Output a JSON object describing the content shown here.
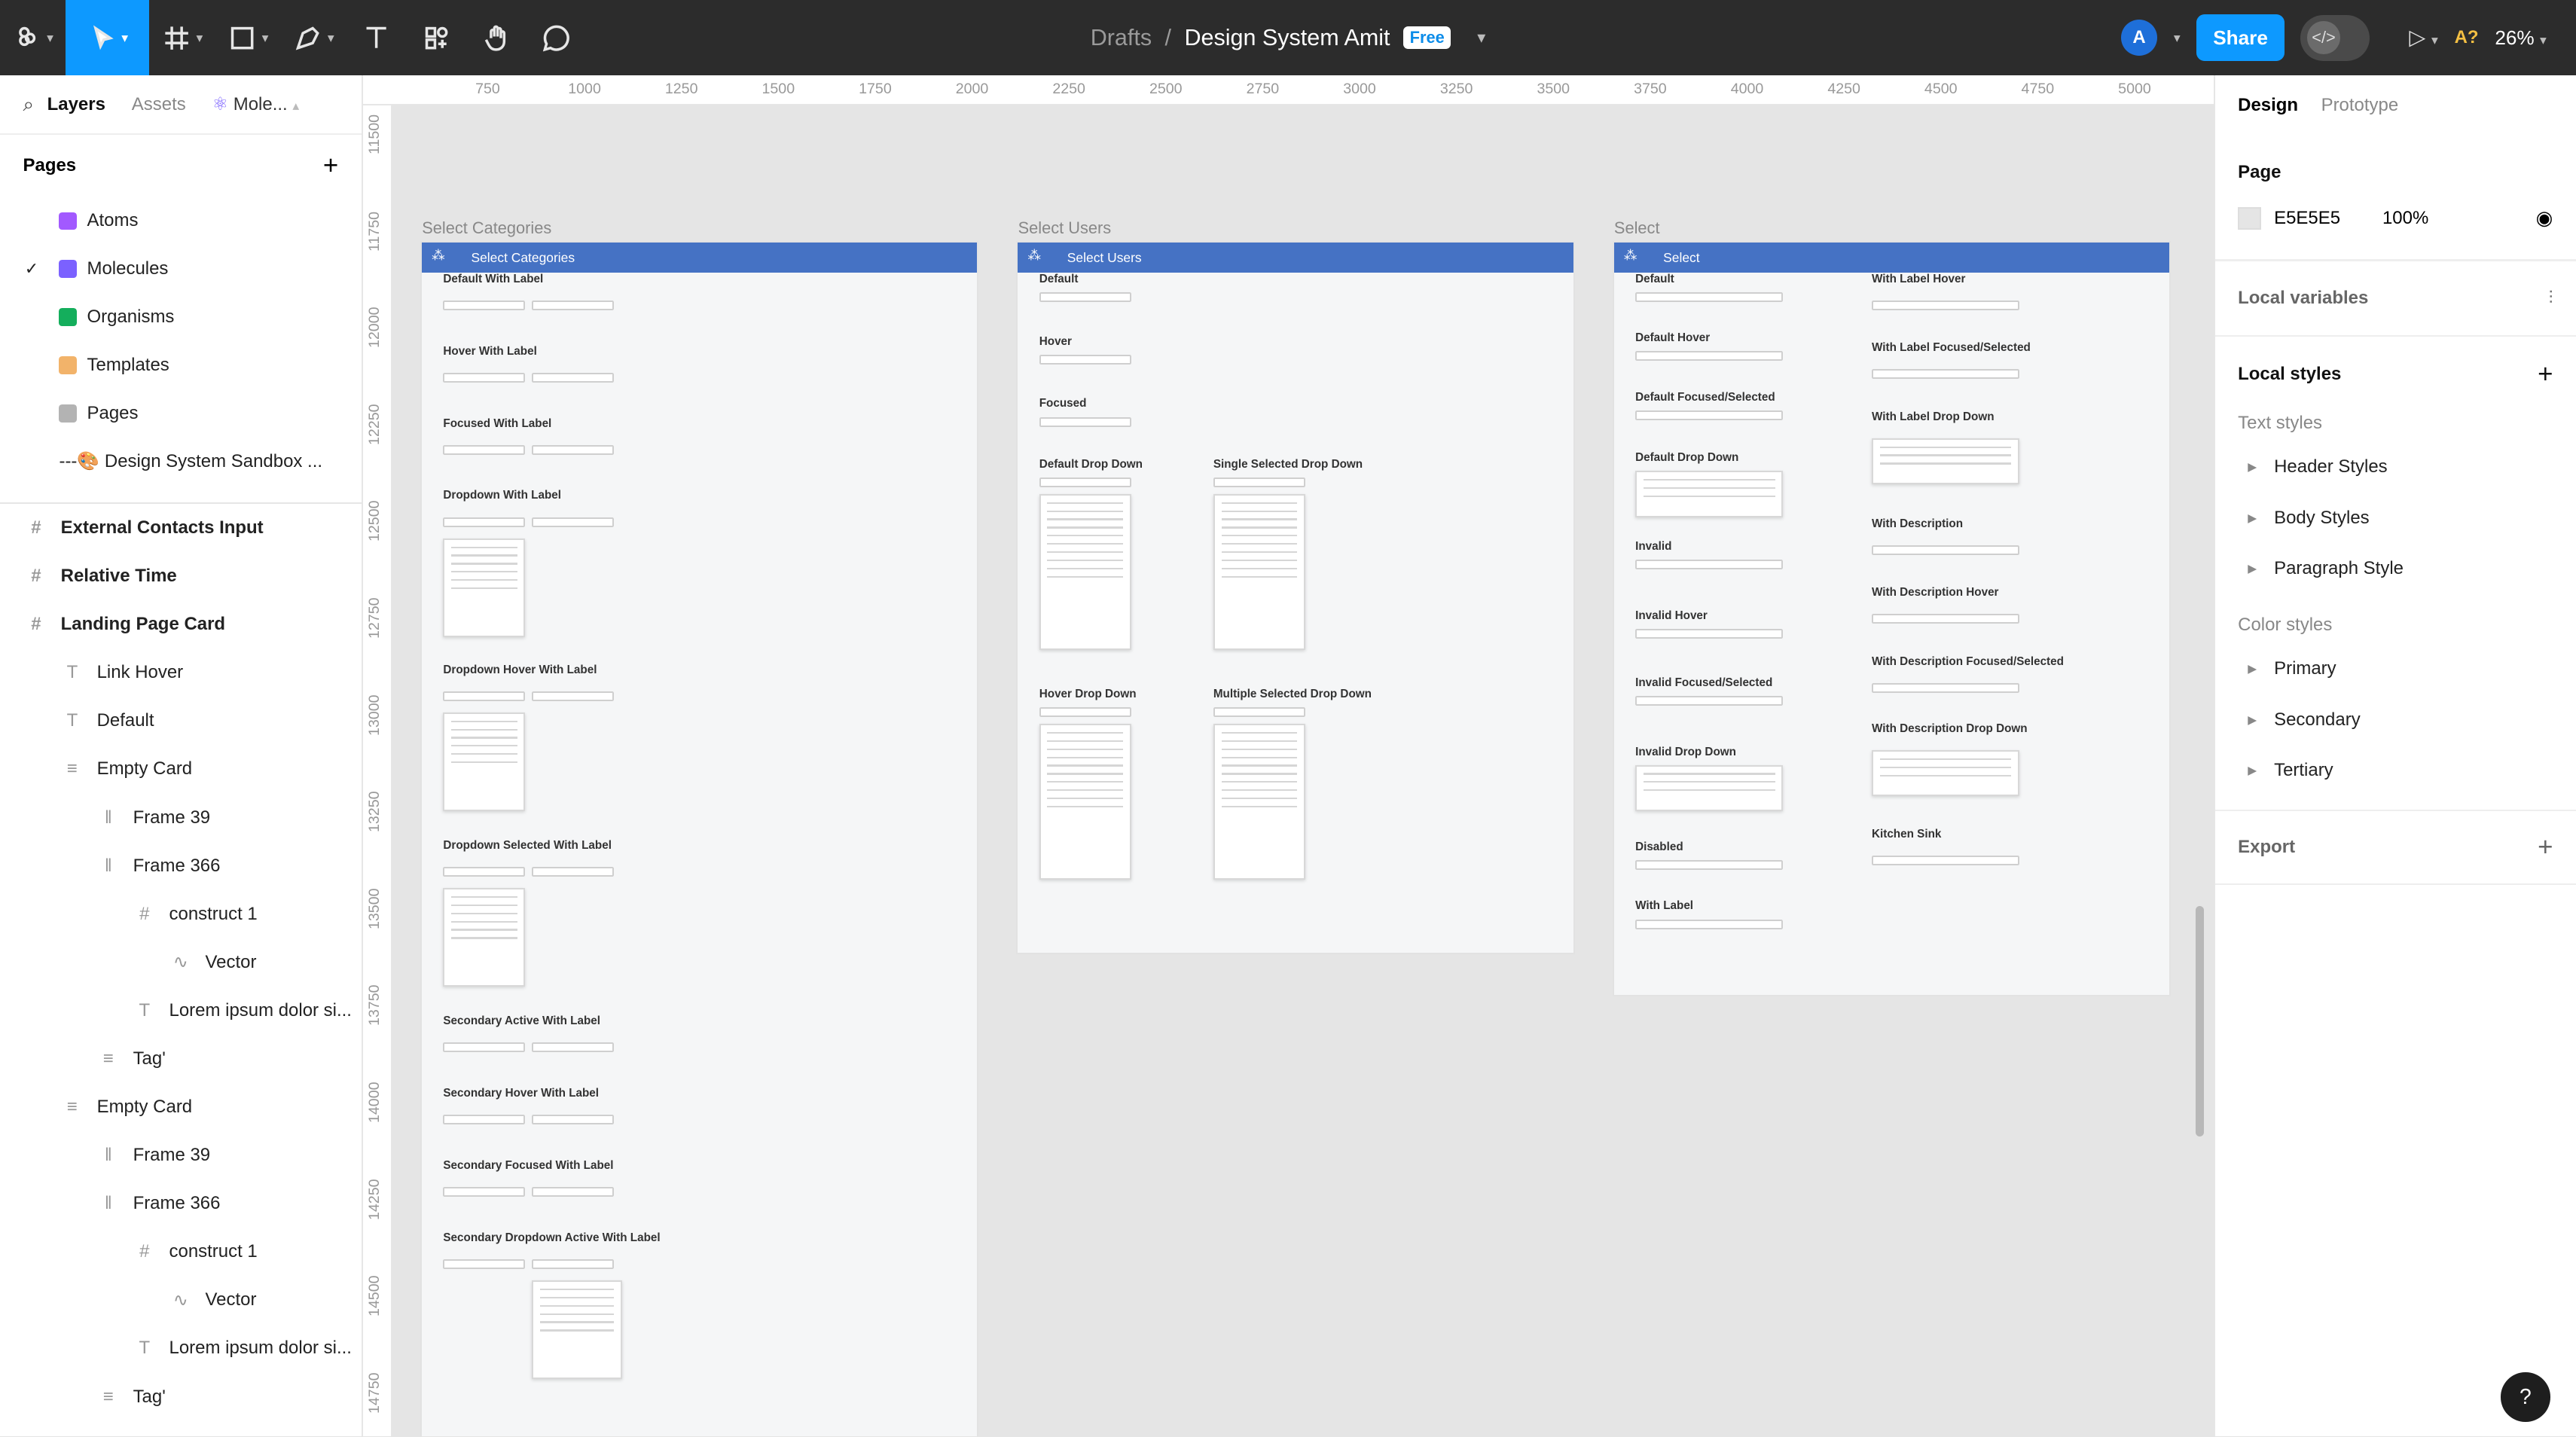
{
  "toolbar": {
    "file_parent": "Drafts",
    "separator": "/",
    "file_name": "Design System Amit",
    "plan_badge": "Free",
    "avatar_initial": "A",
    "share_label": "Share",
    "zoom": "26%",
    "aq": "A?"
  },
  "left_panel": {
    "tabs": {
      "layers": "Layers",
      "assets": "Assets",
      "page_switch": "Mole..."
    },
    "pages_header": "Pages",
    "pages": [
      {
        "label": "Atoms",
        "icon": "atom-icon",
        "color": "#a259ff"
      },
      {
        "label": "Molecules",
        "icon": "molecule-icon",
        "color": "#7b61ff",
        "checked": true
      },
      {
        "label": "Organisms",
        "icon": "leaf-icon",
        "color": "#14ae5c"
      },
      {
        "label": "Templates",
        "icon": "template-icon",
        "color": "#f2b36a"
      },
      {
        "label": "Pages",
        "icon": "page-icon",
        "color": "#b3b3b3"
      },
      {
        "label": "---🎨 Design System Sandbox ...",
        "icon": "",
        "color": ""
      }
    ],
    "layers": [
      {
        "label": "External Contacts Input",
        "icon": "#",
        "indent": 0,
        "bold": true
      },
      {
        "label": "Relative Time",
        "icon": "#",
        "indent": 0,
        "bold": true
      },
      {
        "label": "Landing Page Card",
        "icon": "#",
        "indent": 0,
        "bold": true
      },
      {
        "label": "Link Hover",
        "icon": "T",
        "indent": 1
      },
      {
        "label": "Default",
        "icon": "T",
        "indent": 1
      },
      {
        "label": "Empty Card",
        "icon": "≡",
        "indent": 1
      },
      {
        "label": "Frame 39",
        "icon": "‖",
        "indent": 2
      },
      {
        "label": "Frame 366",
        "icon": "‖",
        "indent": 2
      },
      {
        "label": "construct 1",
        "icon": "#",
        "indent": 3
      },
      {
        "label": "Vector",
        "icon": "∿",
        "indent": 4
      },
      {
        "label": "Lorem ipsum dolor si...",
        "icon": "T",
        "indent": 3
      },
      {
        "label": "Tag'",
        "icon": "≡",
        "indent": 2
      },
      {
        "label": "Empty Card",
        "icon": "≡",
        "indent": 1
      },
      {
        "label": "Frame 39",
        "icon": "‖",
        "indent": 2
      },
      {
        "label": "Frame 366",
        "icon": "‖",
        "indent": 2
      },
      {
        "label": "construct 1",
        "icon": "#",
        "indent": 3
      },
      {
        "label": "Vector",
        "icon": "∿",
        "indent": 4
      },
      {
        "label": "Lorem ipsum dolor si...",
        "icon": "T",
        "indent": 3
      },
      {
        "label": "Tag'",
        "icon": "≡",
        "indent": 2
      }
    ]
  },
  "ruler": {
    "top": [
      "750",
      "1000",
      "1250",
      "1500",
      "1750",
      "2000",
      "2250",
      "2500",
      "2750",
      "3000",
      "3250",
      "3500",
      "3750",
      "4000",
      "4250",
      "4500",
      "4750",
      "5000"
    ],
    "left": [
      "11500",
      "11750",
      "12000",
      "12250",
      "12500",
      "12750",
      "13000",
      "13250",
      "13500",
      "13750",
      "14000",
      "14250",
      "14500",
      "14750"
    ]
  },
  "canvas": {
    "frames": [
      {
        "label": "Select Categories",
        "title": "Select Categories",
        "sections": [
          "Default With Label",
          "Hover With Label",
          "Focused With Label",
          "Dropdown With Label",
          "Dropdown Hover With Label",
          "Dropdown Selected With Label",
          "Secondary Active With Label",
          "Secondary Hover With Label",
          "Secondary Focused With Label",
          "Secondary Dropdown Active With Label"
        ]
      },
      {
        "label": "Select Users",
        "title": "Select Users",
        "sections": [
          "Default",
          "Hover",
          "Focused",
          "Default Drop Down",
          "Single Selected Drop Down",
          "Hover Drop Down",
          "Multiple Selected Drop Down"
        ]
      },
      {
        "label": "Select",
        "title": "Select",
        "sections": [
          "Default",
          "Default Hover",
          "Default Focused/Selected",
          "Default Drop Down",
          "Invalid",
          "Invalid Hover",
          "Invalid Focused/Selected",
          "Invalid Drop Down",
          "Disabled",
          "With Label",
          "With Label Hover",
          "With Label Focused/Selected",
          "With Label Drop Down",
          "With Description",
          "With Description Hover",
          "With Description Focused/Selected",
          "With Description Drop Down",
          "Kitchen Sink"
        ]
      }
    ]
  },
  "right_panel": {
    "tabs": {
      "design": "Design",
      "prototype": "Prototype"
    },
    "page_header": "Page",
    "page_color": "E5E5E5",
    "page_opacity": "100%",
    "local_variables": "Local variables",
    "local_styles": "Local styles",
    "text_styles_header": "Text styles",
    "text_styles": [
      "Header Styles",
      "Body Styles",
      "Paragraph Style"
    ],
    "color_styles_header": "Color styles",
    "color_styles": [
      "Primary",
      "Secondary",
      "Tertiary"
    ],
    "export": "Export"
  },
  "help": "?"
}
